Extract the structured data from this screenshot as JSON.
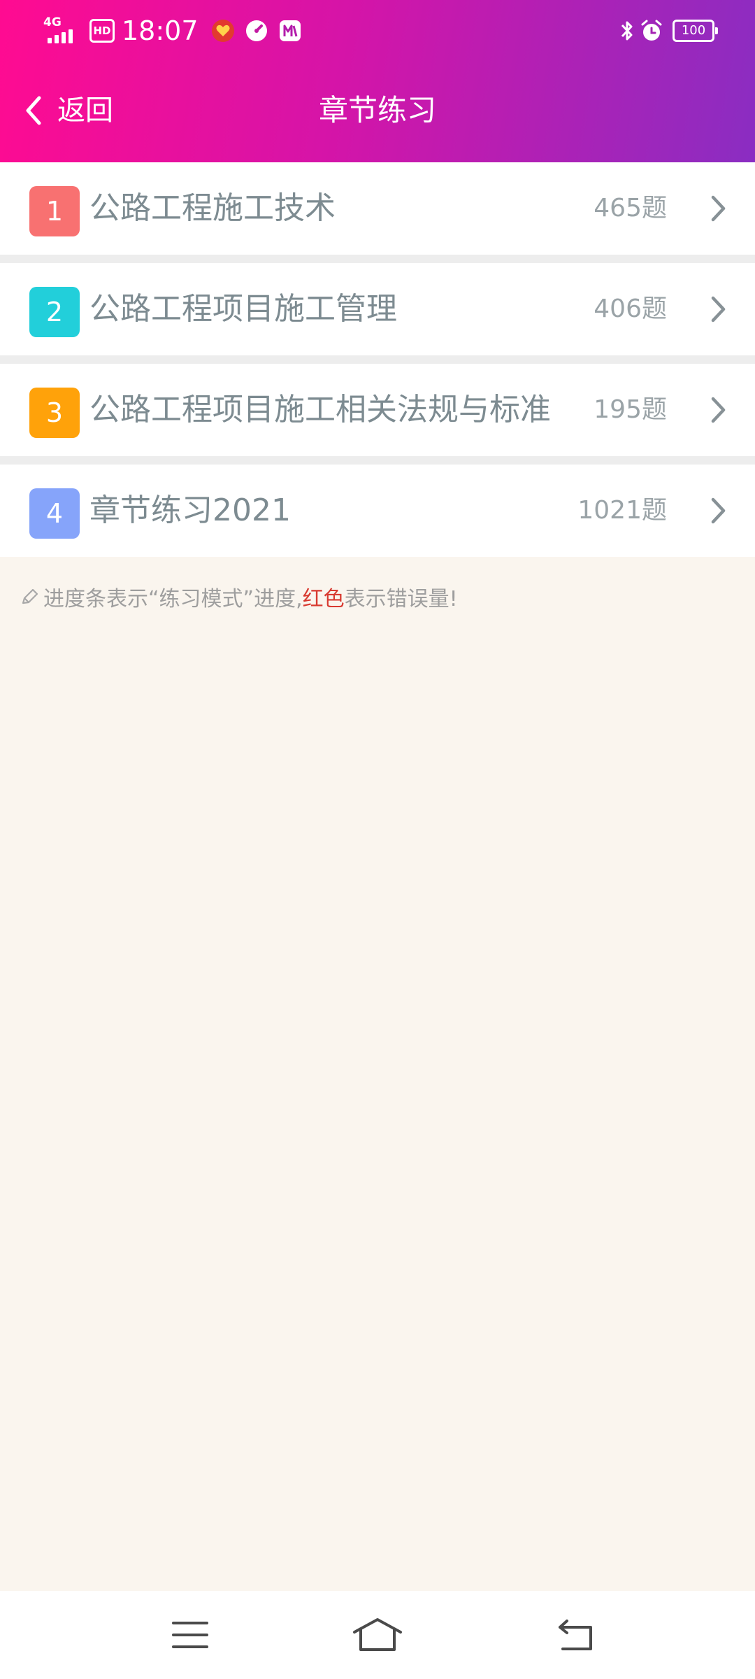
{
  "status_bar": {
    "network": "4G",
    "hd": "HD",
    "time": "18:07",
    "battery": "100"
  },
  "nav": {
    "back_label": "返回",
    "title": "章节练习"
  },
  "chapters": [
    {
      "index": "1",
      "title": "公路工程施工技术",
      "count": "465题",
      "color": "#f87171"
    },
    {
      "index": "2",
      "title": "公路工程项目施工管理",
      "count": "406题",
      "color": "#22cfda"
    },
    {
      "index": "3",
      "title": "公路工程项目施工相关法规与标准",
      "count": "195题",
      "color": "#ffa20a"
    },
    {
      "index": "4",
      "title": "章节练习2021",
      "count": "1021题",
      "color": "#86a4fa"
    }
  ],
  "hint": {
    "prefix": "进度条表示“练习模式”进度,",
    "highlight": "红色",
    "suffix": "表示错误量!"
  },
  "colors": {
    "header_start": "#ff0b91",
    "header_end": "#8a2dc2",
    "page_bg": "#faf5ee",
    "hint_red": "#d83a30"
  },
  "icons": {
    "back": "chevron-left-icon",
    "row_arrow": "chevron-right-icon",
    "hint": "pencil-icon",
    "sys_menu": "menu-icon",
    "sys_home": "home-icon",
    "sys_back": "back-arrow-icon"
  }
}
